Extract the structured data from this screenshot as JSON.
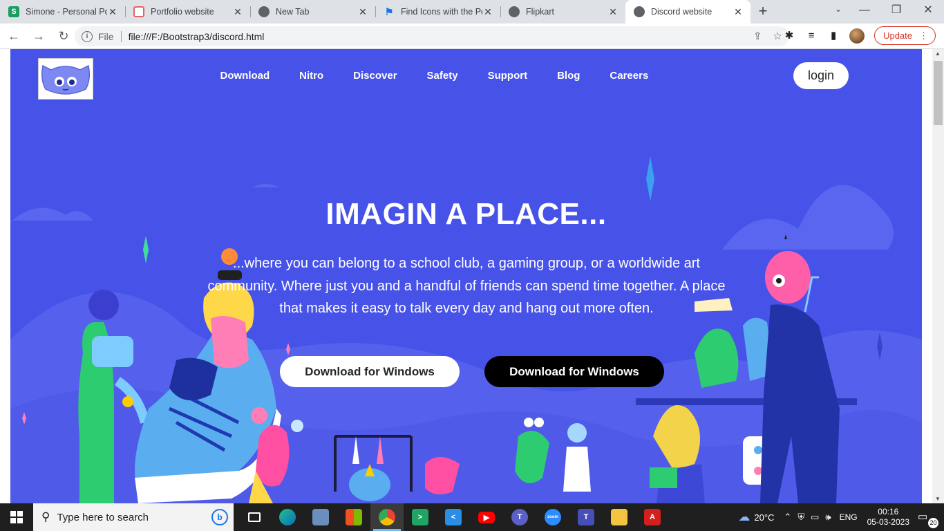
{
  "browser": {
    "tabs": [
      {
        "title": "Simone - Personal Por",
        "favicon": "simone-icon",
        "color": "#1a9e60"
      },
      {
        "title": "Portfolio website",
        "favicon": "portfolio-icon",
        "color": "#e06666"
      },
      {
        "title": "New Tab",
        "favicon": "chrome-icon",
        "color": "#5f6368"
      },
      {
        "title": "Find Icons with the Pe",
        "favicon": "flag-icon",
        "color": "#1a73e8"
      },
      {
        "title": "Flipkart",
        "favicon": "globe-icon",
        "color": "#5f6368"
      },
      {
        "title": "Discord website",
        "favicon": "globe-icon",
        "color": "#5f6368",
        "active": true
      }
    ],
    "address": {
      "scheme_label": "File",
      "url": "file:///F:/Bootstrap3/discord.html"
    },
    "update_label": "Update"
  },
  "page": {
    "nav": [
      "Download",
      "Nitro",
      "Discover",
      "Safety",
      "Support",
      "Blog",
      "Careers"
    ],
    "login_label": "login",
    "headline": "IMAGIN A PLACE...",
    "subtext": "...where you can belong to a school club, a gaming group, or a worldwide art community. Where just you and a handful of friends can spend time together. A place that makes it easy to talk every day and hang out more often.",
    "download_white_label": "Download for Windows",
    "download_black_label": "Download for Windows",
    "colors": {
      "hero_bg": "#4752e8",
      "button_white": "#ffffff",
      "button_black": "#000000"
    }
  },
  "taskbar": {
    "search_placeholder": "Type here to search",
    "apps": [
      "task-view-icon",
      "edge-icon",
      "file-icon",
      "store-icon",
      "chrome-icon",
      "vs-icon",
      "vscode-icon",
      "youtube-icon",
      "teams-icon",
      "zoom-icon",
      "teams-icon",
      "explorer-icon",
      "acrobat-icon"
    ],
    "zoom_app_label": "zoom",
    "weather": "20°C",
    "language": "ENG",
    "time": "00:16",
    "date": "05-03-2023",
    "notification_count": "20"
  }
}
